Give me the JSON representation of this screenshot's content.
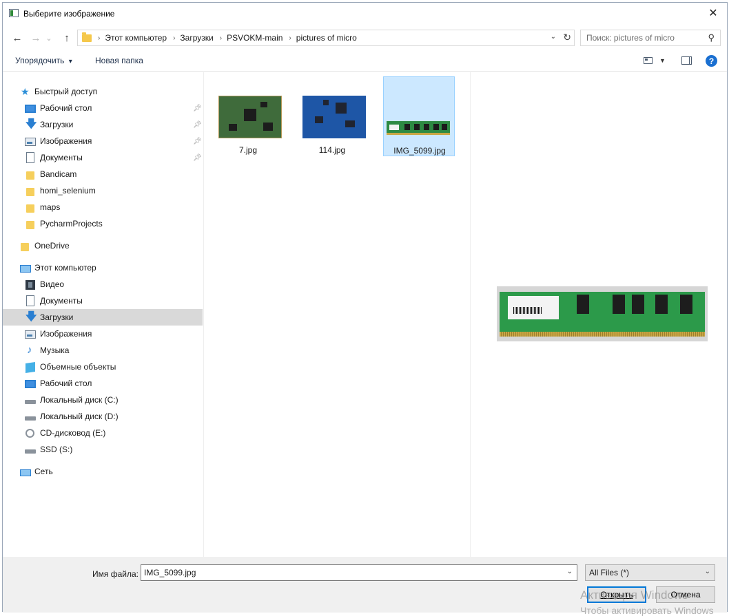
{
  "window": {
    "title": "Выберите изображение",
    "close_glyph": "✕"
  },
  "nav": {
    "back_glyph": "←",
    "forward_glyph": "→",
    "recent_glyph": "⌄",
    "up_glyph": "↑",
    "breadcrumbs": [
      "Этот компьютер",
      "Загрузки",
      "PSVOKM-main",
      "pictures of micro"
    ],
    "search_placeholder": "Поиск: pictures of micro"
  },
  "toolbar": {
    "organize_label": "Упорядочить",
    "organize_arrow": "▾",
    "new_folder_label": "Новая папка",
    "help_glyph": "?"
  },
  "sidebar": {
    "quick_access": "Быстрый доступ",
    "pinned": [
      {
        "label": "Рабочий стол",
        "icon": "desktop-icon"
      },
      {
        "label": "Загрузки",
        "icon": "downloads-icon"
      },
      {
        "label": "Изображения",
        "icon": "pictures-icon"
      },
      {
        "label": "Документы",
        "icon": "documents-icon"
      }
    ],
    "folders": [
      "Bandicam",
      "homi_selenium",
      "maps",
      "PycharmProjects"
    ],
    "onedrive": "OneDrive",
    "this_pc": "Этот компьютер",
    "pc_items": [
      {
        "label": "Видео",
        "icon": "video-icon"
      },
      {
        "label": "Документы",
        "icon": "documents-icon"
      },
      {
        "label": "Загрузки",
        "icon": "downloads-icon",
        "selected": true
      },
      {
        "label": "Изображения",
        "icon": "pictures-icon"
      },
      {
        "label": "Музыка",
        "icon": "music-icon"
      },
      {
        "label": "Объемные объекты",
        "icon": "3d-objects-icon"
      },
      {
        "label": "Рабочий стол",
        "icon": "desktop-icon"
      },
      {
        "label": "Локальный диск (C:)",
        "icon": "system-drive-icon"
      },
      {
        "label": "Локальный диск (D:)",
        "icon": "drive-icon"
      },
      {
        "label": "CD-дисковод (E:)",
        "icon": "cd-drive-icon"
      },
      {
        "label": "SSD (S:)",
        "icon": "drive-icon"
      }
    ],
    "network": "Сеть"
  },
  "files": [
    {
      "name": "7.jpg",
      "selected": false
    },
    {
      "name": "114.jpg",
      "selected": false
    },
    {
      "name": "IMG_5099.jpg",
      "selected": true
    }
  ],
  "footer": {
    "filename_label": "Имя файла:",
    "filename_value": "IMG_5099.jpg",
    "filter_value": "All Files (*)",
    "open_label": "Открыть",
    "cancel_label": "Отмена"
  },
  "watermark": {
    "line1": "Активация Windows",
    "line2": "Чтобы активировать Windows"
  }
}
